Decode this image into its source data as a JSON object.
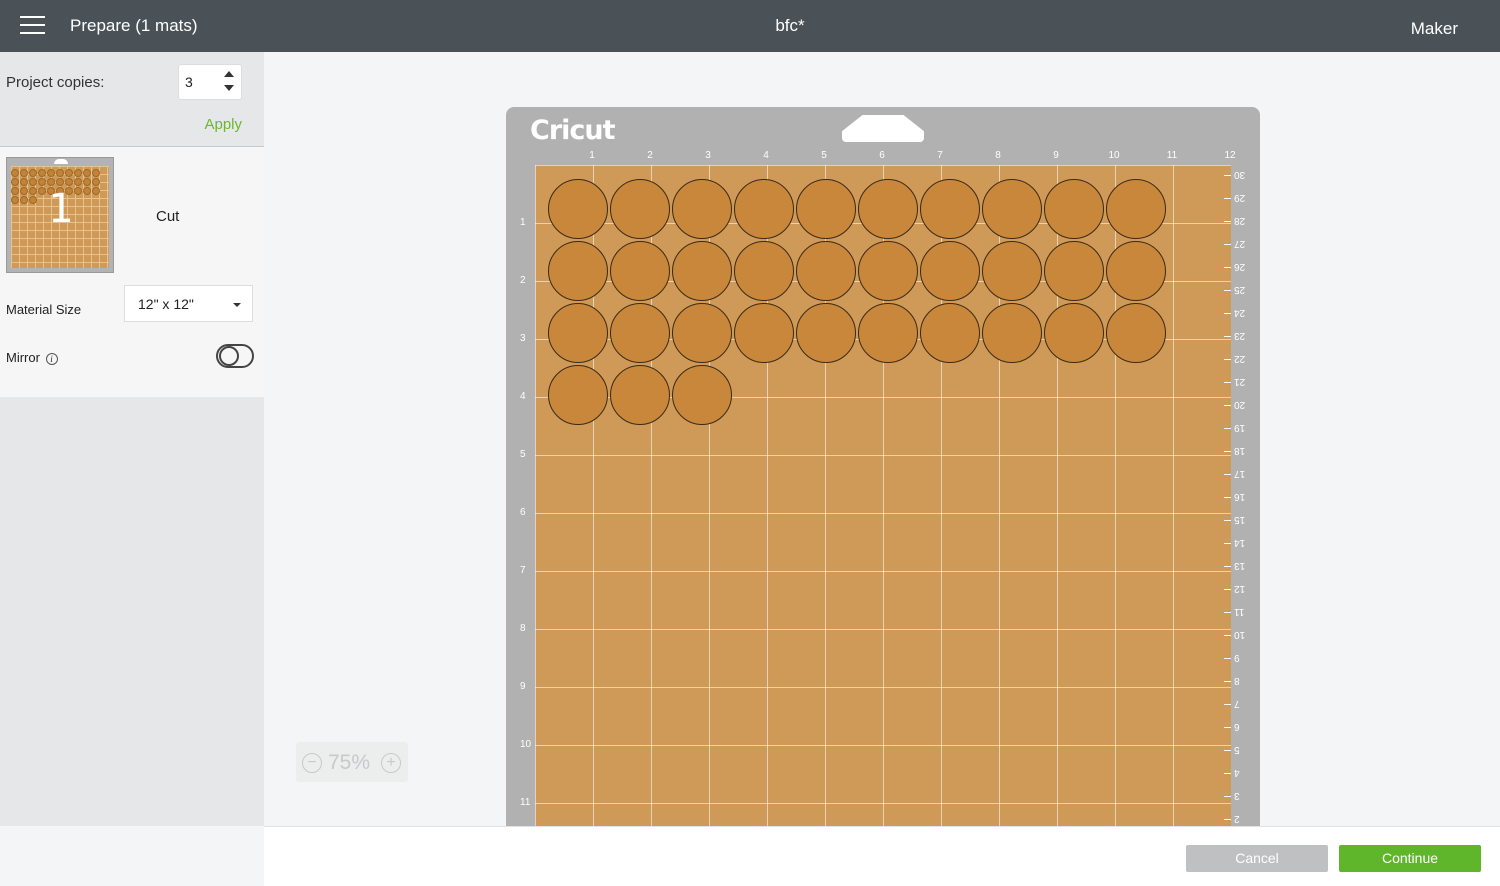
{
  "header": {
    "title": "Prepare (1 mats)",
    "document_name": "bfc*",
    "machine": "Maker",
    "menu_icon": "hamburger-menu-icon"
  },
  "left_panel": {
    "project_copies_label": "Project copies:",
    "project_copies_value": "3",
    "apply_label": "Apply",
    "mat_thumbnail_number": "1",
    "mat_operation": "Cut",
    "material_size_label": "Material Size",
    "material_size_value": "12\" x 12\"",
    "mirror_label": "Mirror",
    "mirror_on": false,
    "info_icon": "info-icon"
  },
  "mat": {
    "brand": "Cricut",
    "top_ruler": [
      "1",
      "2",
      "3",
      "4",
      "5",
      "6",
      "7",
      "8",
      "9",
      "10",
      "11",
      "12"
    ],
    "left_ruler": [
      "1",
      "2",
      "3",
      "4",
      "5",
      "6",
      "7",
      "8",
      "9",
      "10",
      "11"
    ],
    "right_ruler": [
      "30",
      "29",
      "28",
      "27",
      "26",
      "25",
      "24",
      "23",
      "22",
      "21",
      "20",
      "19",
      "18",
      "17",
      "16",
      "15",
      "14",
      "13",
      "12",
      "11",
      "10",
      "9",
      "8",
      "7",
      "6",
      "5",
      "4",
      "3",
      "2"
    ],
    "circle_rows": [
      10,
      10,
      10,
      3
    ],
    "material_color": "#cf9a57",
    "shape_color": "#c8873a"
  },
  "zoom": {
    "level": "75%",
    "minus_icon": "zoom-out-icon",
    "plus_icon": "zoom-in-icon"
  },
  "footer": {
    "cancel_label": "Cancel",
    "continue_label": "Continue"
  },
  "colors": {
    "header_bg": "#4b5257",
    "accent_green": "#5fb62a",
    "apply_green": "#6cb82a"
  }
}
